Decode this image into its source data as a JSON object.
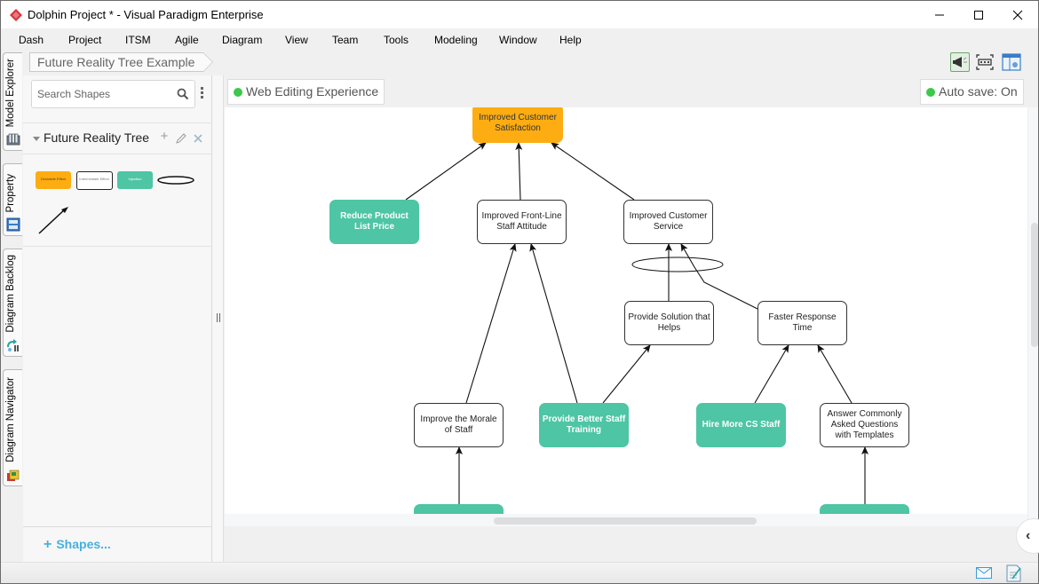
{
  "window": {
    "title": "Dolphin Project * - Visual Paradigm Enterprise",
    "controls": [
      "minimize",
      "maximize",
      "close"
    ]
  },
  "menu": [
    "Dash",
    "Project",
    "ITSM",
    "Agile",
    "Diagram",
    "View",
    "Team",
    "Tools",
    "Modeling",
    "Window",
    "Help"
  ],
  "side_tabs": [
    {
      "label": "Model Explorer",
      "icon": "model-explorer-icon"
    },
    {
      "label": "Property",
      "icon": "property-icon"
    },
    {
      "label": "Diagram Backlog",
      "icon": "diagram-backlog-icon"
    },
    {
      "label": "Diagram Navigator",
      "icon": "diagram-navigator-icon"
    }
  ],
  "breadcrumb": "Future Reality Tree Example",
  "palette": {
    "search_placeholder": "Search Shapes",
    "group_title": "Future Reality Tree",
    "shapes": [
      {
        "name": "Desirable Effect",
        "kind": "desired"
      },
      {
        "name": "Intermediate Effect",
        "kind": "effect"
      },
      {
        "name": "Injection",
        "kind": "inject"
      },
      {
        "name": "Ellipse (AND connector)",
        "kind": "ellipse"
      },
      {
        "name": "Arrow",
        "kind": "arrow"
      }
    ],
    "more_shapes_label": "Shapes..."
  },
  "canvas": {
    "web_editing_label": "Web Editing Experience",
    "autosave_label": "Auto save: On",
    "status_color": "#3cc84a",
    "nodes": [
      {
        "id": "ics",
        "label": "Improved Customer Satisfaction",
        "kind": "desired"
      },
      {
        "id": "rplp",
        "label": "Reduce Product List Price",
        "kind": "inject"
      },
      {
        "id": "iflsa",
        "label": "Improved Front-Line Staff Attitude",
        "kind": "effect"
      },
      {
        "id": "icsv",
        "label": "Improved Customer Service",
        "kind": "effect"
      },
      {
        "id": "psth",
        "label": "Provide Solution that Helps",
        "kind": "effect"
      },
      {
        "id": "frt",
        "label": "Faster Response Time",
        "kind": "effect"
      },
      {
        "id": "imos",
        "label": "Improve the Morale of Staff",
        "kind": "effect"
      },
      {
        "id": "pbst",
        "label": "Provide Better Staff Training",
        "kind": "inject"
      },
      {
        "id": "hmcs",
        "label": "Hire More CS Staff",
        "kind": "inject"
      },
      {
        "id": "acaq",
        "label": "Answer Commonly Asked Questions with Templates",
        "kind": "effect"
      },
      {
        "id": "bottom1",
        "label": "",
        "kind": "inject"
      },
      {
        "id": "bottom2",
        "label": "",
        "kind": "inject"
      }
    ],
    "edges": [
      {
        "from": "rplp",
        "to": "ics"
      },
      {
        "from": "iflsa",
        "to": "ics"
      },
      {
        "from": "icsv",
        "to": "ics"
      },
      {
        "from": "imos",
        "to": "iflsa"
      },
      {
        "from": "pbst",
        "to": "iflsa"
      },
      {
        "from": "psth",
        "to": "icsv"
      },
      {
        "from": "frt",
        "to": "icsv"
      },
      {
        "from": "pbst",
        "to": "psth"
      },
      {
        "from": "hmcs",
        "to": "frt"
      },
      {
        "from": "acaq",
        "to": "frt"
      },
      {
        "from": "bottom1",
        "to": "imos"
      },
      {
        "from": "bottom2",
        "to": "acaq"
      }
    ],
    "colors": {
      "desired": "#fdad12",
      "inject": "#4ec5a5",
      "effect_border": "#333333"
    }
  },
  "colors": {
    "link": "#45b0e0",
    "status_green": "#3cc84a"
  }
}
